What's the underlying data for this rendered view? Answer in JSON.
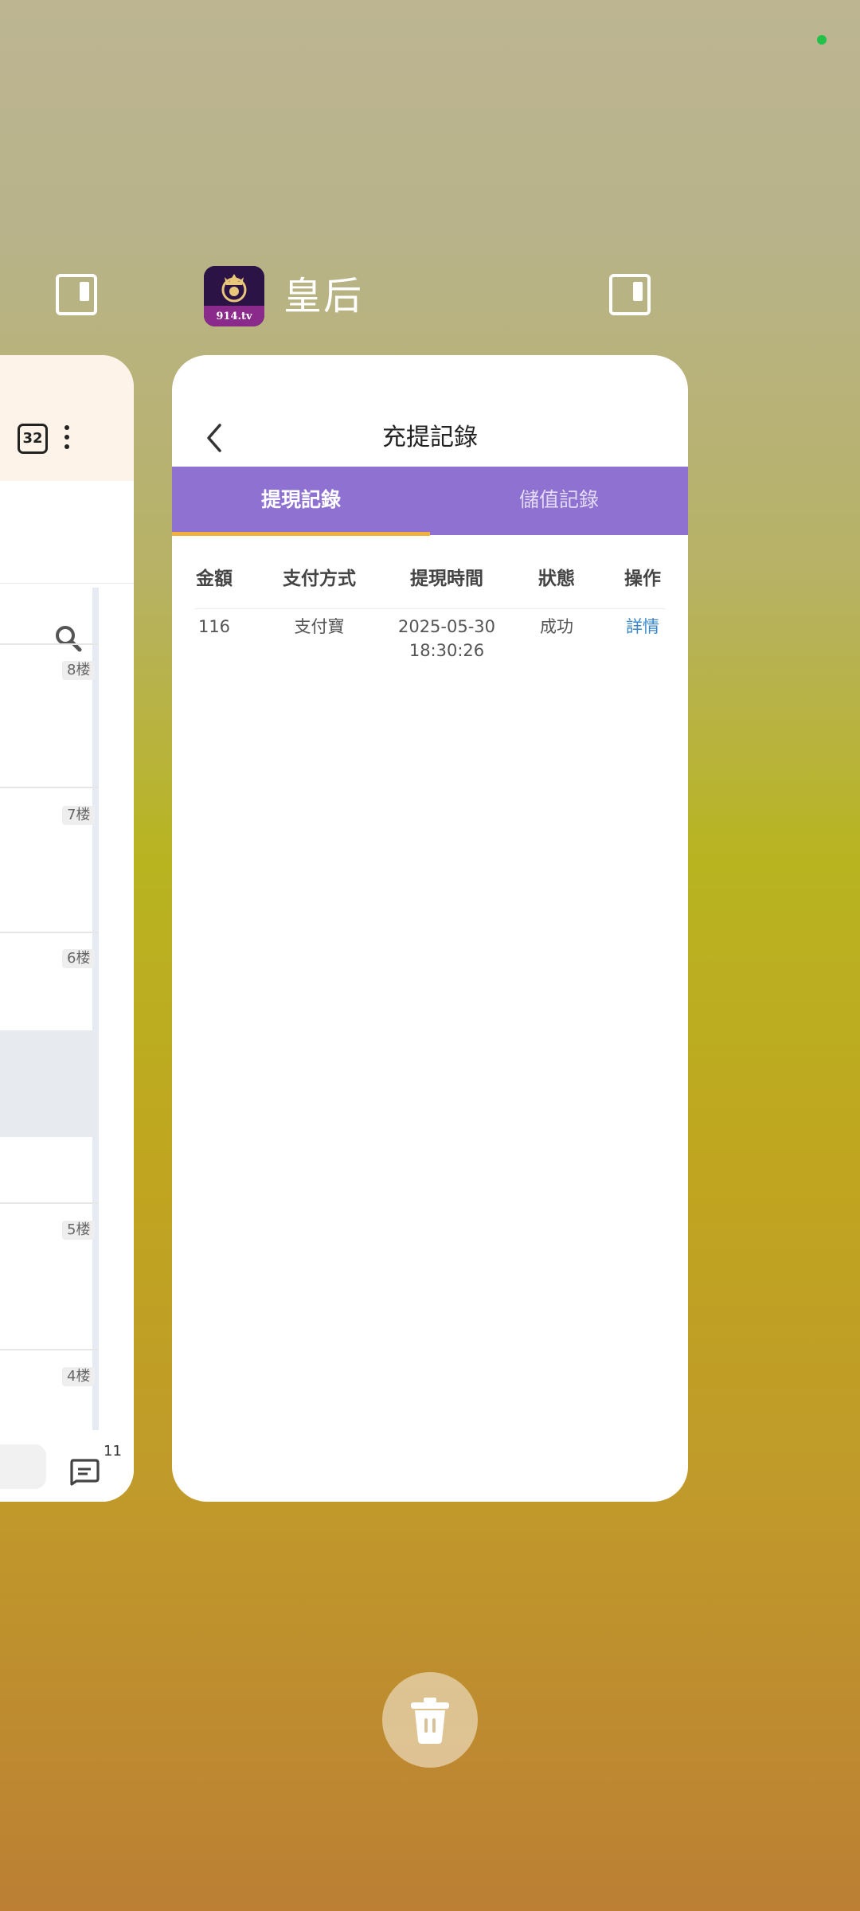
{
  "app": {
    "title": "皇后",
    "icon": "queen-crest-icon",
    "icon_text": "914.tv"
  },
  "left_card": {
    "tab_count": "32",
    "floor_badges": [
      "8楼",
      "7楼",
      "6楼",
      "5楼",
      "4楼"
    ],
    "comment_count": "11"
  },
  "main_card": {
    "page_title": "充提記錄",
    "tabs": [
      {
        "label": "提現記錄",
        "active": true
      },
      {
        "label": "儲值記錄",
        "active": false
      }
    ],
    "table": {
      "headers": [
        "金額",
        "支付方式",
        "提現時間",
        "狀態",
        "操作"
      ],
      "rows": [
        {
          "amount": "116",
          "method": "支付寶",
          "date": "2025-05-30",
          "time": "18:30:26",
          "status": "成功",
          "action": "詳情"
        }
      ]
    }
  },
  "colors": {
    "tab_bar": "#8e71d0",
    "tab_underline": "#f1b13a",
    "link": "#3a86c8",
    "status_dot": "#22c24a"
  }
}
